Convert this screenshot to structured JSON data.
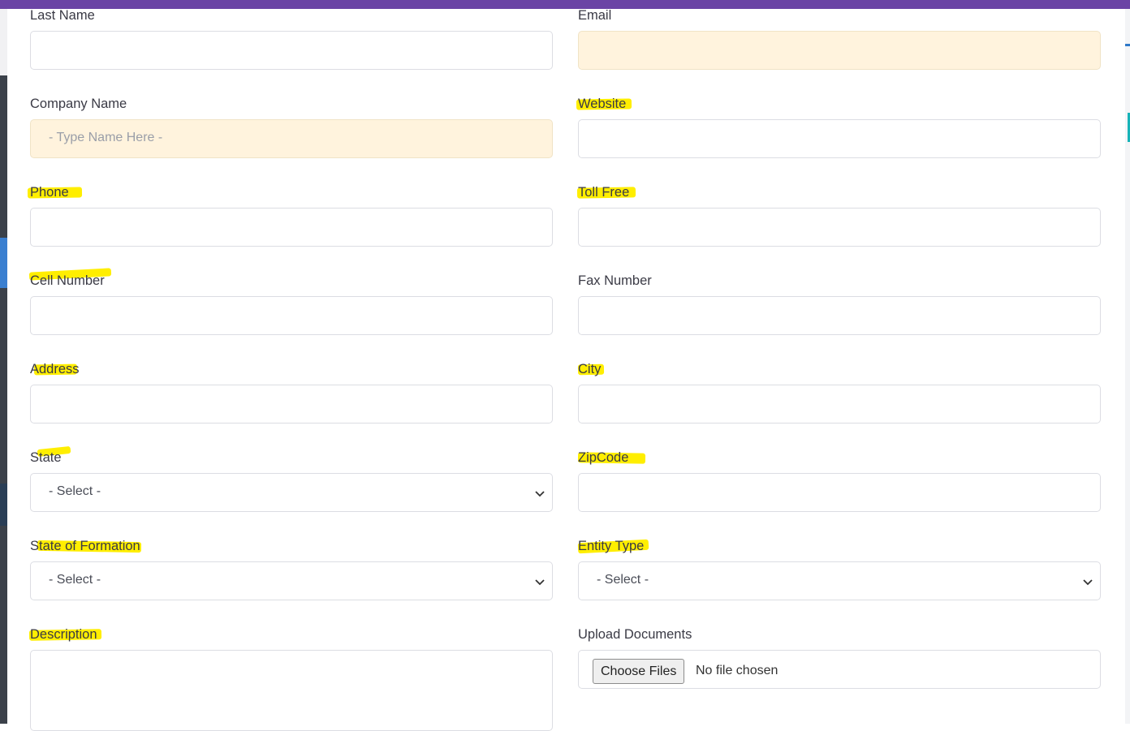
{
  "form": {
    "last_name": {
      "label": "Last Name",
      "value": ""
    },
    "email": {
      "label": "Email",
      "value": ""
    },
    "company_name": {
      "label": "Company Name",
      "placeholder": "- Type Name Here -"
    },
    "website": {
      "label": "Website",
      "value": ""
    },
    "phone": {
      "label": "Phone",
      "value": ""
    },
    "toll_free": {
      "label": "Toll Free",
      "value": ""
    },
    "cell_number": {
      "label": "Cell Number",
      "value": ""
    },
    "fax_number": {
      "label": "Fax Number",
      "value": ""
    },
    "address": {
      "label": "Address",
      "value": ""
    },
    "city": {
      "label": "City",
      "value": ""
    },
    "state": {
      "label": "State",
      "selected": "- Select -"
    },
    "zipcode": {
      "label": "ZipCode",
      "value": ""
    },
    "state_of_formation": {
      "label": "State of Formation",
      "selected": "- Select -"
    },
    "entity_type": {
      "label": "Entity Type",
      "selected": "- Select -"
    },
    "description": {
      "label": "Description",
      "value": ""
    },
    "upload_documents": {
      "label": "Upload Documents",
      "button_label": "Choose Files",
      "status": "No file chosen"
    }
  },
  "colors": {
    "top_bar": "#6b44a5",
    "highlight": "#ffee00",
    "tinted_field": "#fff3dd",
    "border": "#dcdde3"
  },
  "icons": {
    "select": "chevron-down-icon"
  }
}
